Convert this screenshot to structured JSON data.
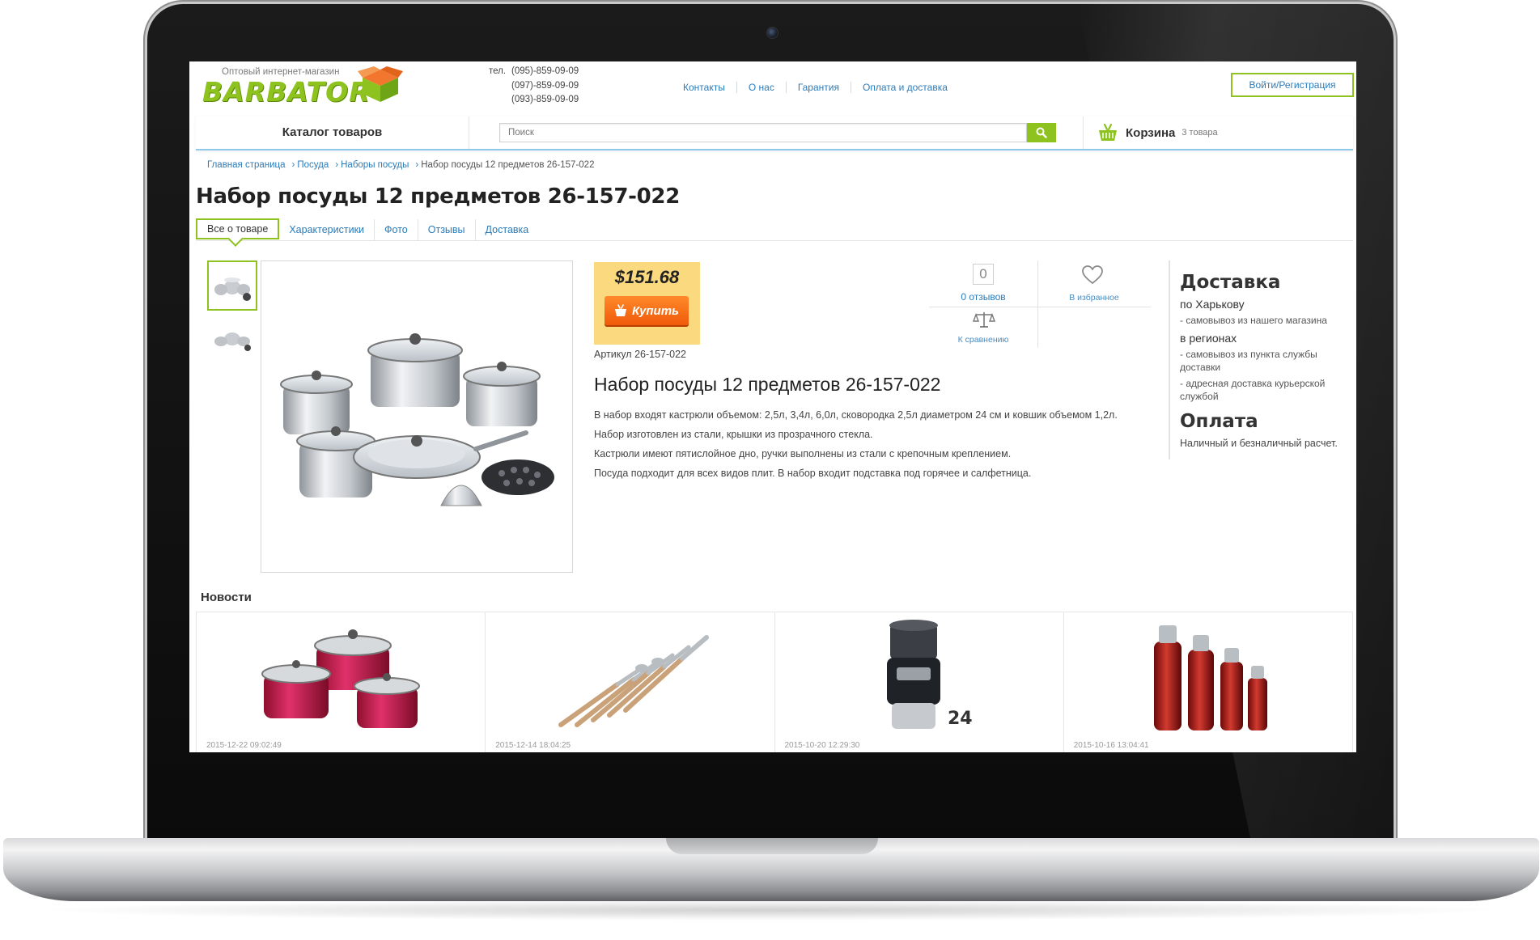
{
  "header": {
    "logo_tagline": "Оптовый интернет-магазин",
    "logo_word": "BARBATOR",
    "phone_label": "тел.",
    "phones": [
      "(095)-859-09-09",
      "(097)-859-09-09",
      "(093)-859-09-09"
    ],
    "nav": [
      "Контакты",
      "О нас",
      "Гарантия",
      "Оплата и доставка"
    ],
    "login": "Войти/Регистрация"
  },
  "catbar": {
    "catalog": "Каталог товаров",
    "search_placeholder": "Поиск",
    "cart_label": "Корзина",
    "cart_count": "3 товара"
  },
  "breadcrumb": [
    "Главная страница",
    "Посуда",
    "Наборы посуды",
    "Набор посуды 12 предметов 26-157-022"
  ],
  "page_title": "Набор посуды 12 предметов 26-157-022",
  "tabs": [
    "Все о товаре",
    "Характеристики",
    "Фото",
    "Отзывы",
    "Доставка"
  ],
  "product": {
    "price": "$151.68",
    "buy": "Купить",
    "article": "Артикул 26-157-022",
    "reviews_count": "0",
    "reviews_link": "0 отзывов",
    "favorites": "В избранное",
    "compare": "К сравнению",
    "title": "Набор посуды 12 предметов 26-157-022",
    "description": [
      "В набор входят кастрюли объемом: 2,5л, 3,4л, 6,0л, сковородка 2,5л диаметром 24 см и ковшик объемом 1,2л.",
      "Набор изготовлен из стали, крышки из прозрачного стекла.",
      "Кастрюли имеют пятислойное дно, ручки выполнены из стали с крепочным креплением.",
      "Посуда подходит для всех видов плит. В набор входит подставка под горячее и салфетница."
    ]
  },
  "delivery": {
    "title": "Доставка",
    "city": "по Харькову",
    "city_items": [
      "- самовывоз из нашего магазина"
    ],
    "regions": "в регионах",
    "region_items": [
      "- самовывоз из пункта службы доставки",
      "- адресная доставка курьерской службой"
    ],
    "pay_title": "Оплата",
    "pay_text": "Наличный и безналичный расчет."
  },
  "news": {
    "title": "Новости",
    "items": [
      {
        "date": "2015-12-22 09:02:49"
      },
      {
        "date": "2015-12-14 18:04:25"
      },
      {
        "date": "2015-10-20 12:29:30"
      },
      {
        "date": "2015-10-16 13:04:41"
      }
    ],
    "badge": "24"
  },
  "colors": {
    "accent_green": "#8dc21f",
    "link_blue": "#2b7bb9",
    "price_bg": "#fbd97e",
    "buy_orange": "#f05a0a"
  }
}
